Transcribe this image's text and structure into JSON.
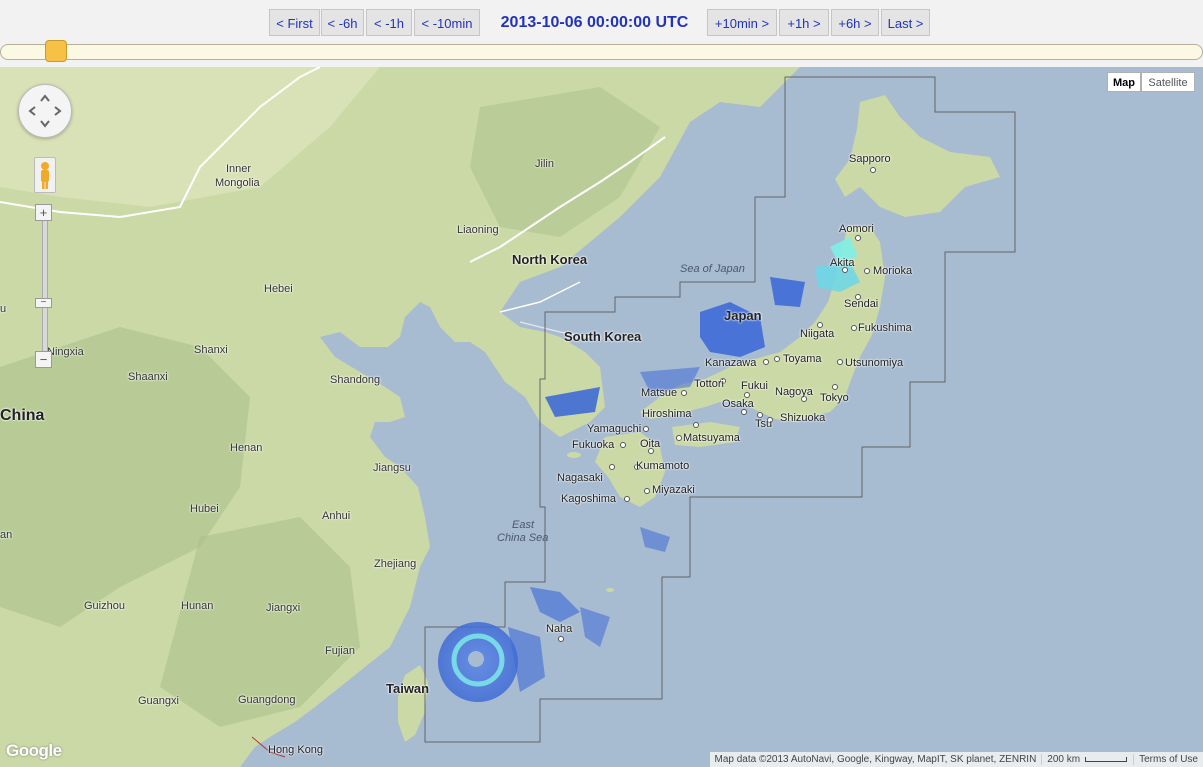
{
  "toolbar": {
    "first_label": "< First",
    "minus6h_label": "< -6h",
    "minus1h_label": "< -1h",
    "minus10min_label": "< -10min",
    "timestamp": "2013-10-06 00:00:00 UTC",
    "plus10min_label": "+10min >",
    "plus1h_label": "+1h >",
    "plus6h_label": "+6h >",
    "last_label": "Last >"
  },
  "timeline": {
    "position_fraction": 0.047
  },
  "map": {
    "maptype": {
      "map_label": "Map",
      "satellite_label": "Satellite",
      "selected": "Map"
    },
    "labels": {
      "china": "China",
      "inner": "Inner",
      "mongolia": "Mongolia",
      "jilin": "Jilin",
      "liaoning": "Liaoning",
      "north_korea": "North Korea",
      "south_korea": "South Korea",
      "japan": "Japan",
      "sea_of_japan": "Sea of Japan",
      "hebei": "Hebei",
      "ningxia": "Ningxia",
      "shanxi": "Shanxi",
      "shaanxi": "Shaanxi",
      "shandong": "Shandong",
      "henan": "Henan",
      "jiangsu": "Jiangsu",
      "hubei": "Hubei",
      "anhui": "Anhui",
      "zhejiang": "Zhejiang",
      "guizhou": "Guizhou",
      "hunan": "Hunan",
      "jiangxi": "Jiangxi",
      "fujian": "Fujian",
      "guangxi": "Guangxi",
      "guangdong": "Guangdong",
      "hong_kong": "Hong Kong",
      "taiwan": "Taiwan",
      "east": "East",
      "china_sea": "China Sea",
      "sapporo": "Sapporo",
      "aomori": "Aomori",
      "akita": "Akita",
      "morioka": "Morioka",
      "sendai": "Sendai",
      "niigata": "Niigata",
      "fukushima": "Fukushima",
      "kanazawa": "Kanazawa",
      "toyama": "Toyama",
      "utsunomiya": "Utsunomiya",
      "tottori": "Tottori",
      "matsue": "Matsue",
      "fukui": "Fukui",
      "nagoya": "Nagoya",
      "tokyo": "Tokyo",
      "hiroshima": "Hiroshima",
      "osaka": "Osaka",
      "tsu": "Tsu",
      "shizuoka": "Shizuoka",
      "yamaguchi": "Yamaguchi",
      "fukuoka": "Fukuoka",
      "oita": "Oita",
      "matsuyama": "Matsuyama",
      "nagasaki": "Nagasaki",
      "kumamoto": "Kumamoto",
      "kagoshima": "Kagoshima",
      "miyazaki": "Miyazaki",
      "naha": "Naha",
      "edge_u": "u",
      "edge_an": "an"
    },
    "logo": "Google",
    "attribution": "Map data ©2013 AutoNavi, Google, Kingway, MapIT, SK planet, ZENRIN",
    "scale": "200 km",
    "terms": "Terms of Use",
    "colors": {
      "water": "#a7bbd1",
      "land": "#cbd9a7",
      "radar_low": "#3f6bd6",
      "radar_high": "#7ff0e8"
    }
  }
}
